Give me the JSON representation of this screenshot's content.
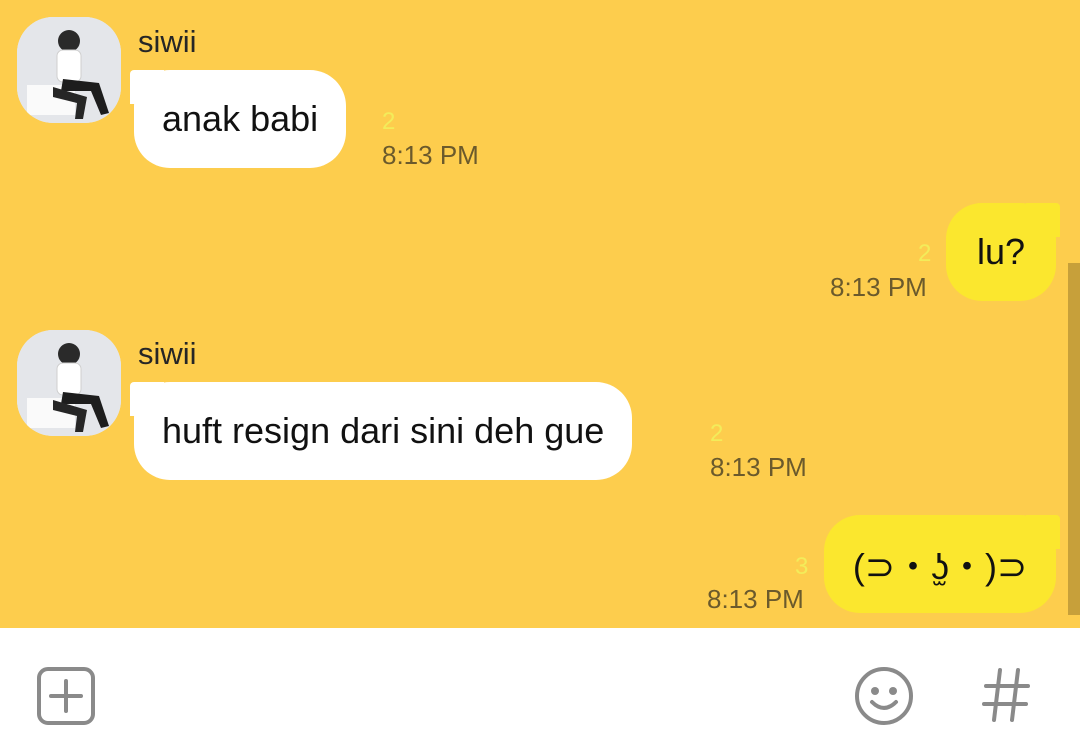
{
  "messages": [
    {
      "direction": "incoming",
      "sender": "siwii",
      "text": "anak babi",
      "unread": "2",
      "time": "8:13 PM"
    },
    {
      "direction": "outgoing",
      "text": "lu?",
      "unread": "2",
      "time": "8:13 PM"
    },
    {
      "direction": "incoming",
      "sender": "siwii",
      "text": "huft resign dari sini deh gue",
      "unread": "2",
      "time": "8:13 PM"
    },
    {
      "direction": "outgoing",
      "text": "(⊃・ʖ̫・)⊃",
      "unread": "3",
      "time": "8:13 PM"
    }
  ],
  "input_bar": {
    "icons": [
      "plus-square-icon",
      "emoji-smile-icon",
      "hashtag-icon"
    ]
  },
  "colors": {
    "chat_background": "#fdcd4d",
    "incoming_bubble": "#ffffff",
    "outgoing_bubble": "#fbe72e",
    "unread_count": "#f3ec5a",
    "timestamp": "#6b5a2c"
  }
}
